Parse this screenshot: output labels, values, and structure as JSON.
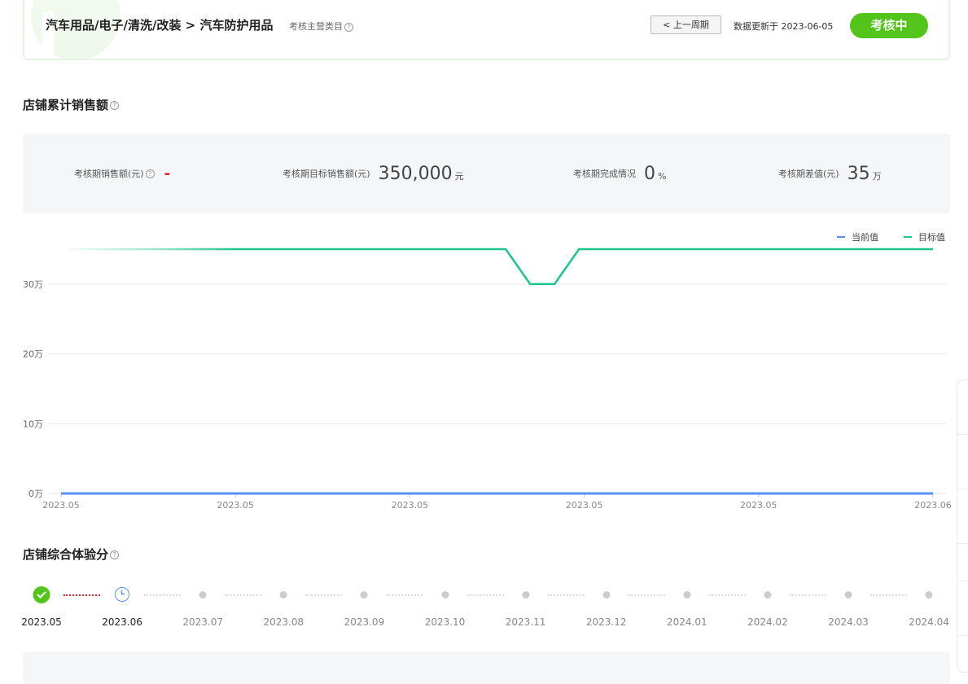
{
  "header": {
    "breadcrumb": "汽车用品/电子/清洗/改装 > 汽车防护用品",
    "category_tag": "考核主营类目",
    "prev_button": "< 上一周期",
    "update_text": "数据更新于 2023-06-05",
    "status": "考核中"
  },
  "sales_section": {
    "title": "店铺累计销售额",
    "metrics": [
      {
        "label": "考核期销售额(元)",
        "value": "-",
        "unit": ""
      },
      {
        "label": "考核期目标销售额(元)",
        "value": "350,000",
        "unit": "元"
      },
      {
        "label": "考核期完成情况",
        "value": "0",
        "unit": "%"
      },
      {
        "label": "考核期差值(元)",
        "value": "35",
        "unit": "万"
      }
    ]
  },
  "chart_data": {
    "type": "line",
    "title": "",
    "xlabel": "",
    "ylabel": "",
    "legend": [
      "当前值",
      "目标值"
    ],
    "legend_position": "top-right",
    "x_ticks": [
      "2023.05",
      "2023.05",
      "2023.05",
      "2023.05",
      "2023.05",
      "2023.06"
    ],
    "y_ticks": [
      "0万",
      "10万",
      "20万",
      "30万"
    ],
    "ylim": [
      0,
      350000
    ],
    "grid": true,
    "series": [
      {
        "name": "当前值",
        "color": "#5b8ff9",
        "x": [
          0,
          1
        ],
        "y": [
          0,
          0
        ]
      },
      {
        "name": "目标值",
        "color": "#1cc58d",
        "x": [
          0,
          0.51,
          0.538,
          0.566,
          0.594,
          1
        ],
        "y": [
          350000,
          350000,
          300000,
          300000,
          350000,
          350000
        ]
      }
    ]
  },
  "experience_section": {
    "title": "店铺综合体验分",
    "timeline": [
      {
        "label": "2023.05",
        "state": "done"
      },
      {
        "label": "2023.06",
        "state": "current"
      },
      {
        "label": "2023.07",
        "state": "future"
      },
      {
        "label": "2023.08",
        "state": "future"
      },
      {
        "label": "2023.09",
        "state": "future"
      },
      {
        "label": "2023.10",
        "state": "future"
      },
      {
        "label": "2023.11",
        "state": "future"
      },
      {
        "label": "2023.12",
        "state": "future"
      },
      {
        "label": "2024.01",
        "state": "future"
      },
      {
        "label": "2024.02",
        "state": "future"
      },
      {
        "label": "2024.03",
        "state": "future"
      },
      {
        "label": "2024.04",
        "state": "future"
      }
    ]
  },
  "icons": {
    "help": "question-circle-icon",
    "done": "check-circle-icon",
    "current": "clock-icon"
  },
  "colors": {
    "accent": "#52c41a",
    "current_series": "#5b8ff9",
    "target_series": "#1cc58d",
    "negative": "#e8202a"
  }
}
